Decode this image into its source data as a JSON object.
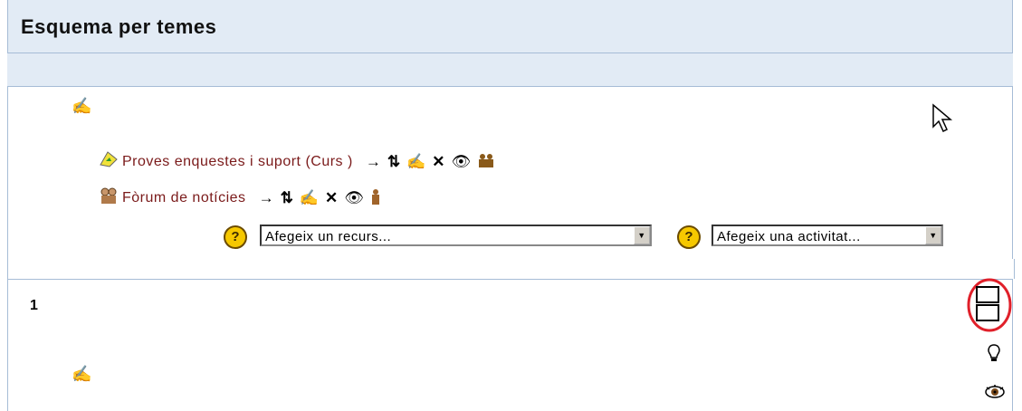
{
  "header": {
    "title": "Esquema per temes"
  },
  "section0": {
    "items": [
      {
        "label": "Proves enquestes i suport (Curs )",
        "icon": "chat-icon"
      },
      {
        "label": "Fòrum de notícies",
        "icon": "forum-icon"
      }
    ],
    "tool_icons": [
      "move-right-icon",
      "move-updown-icon",
      "edit-icon",
      "delete-icon",
      "visibility-icon",
      "groups-icon"
    ],
    "add_resource": {
      "value": "Afegeix un recurs..."
    },
    "add_activity": {
      "value": "Afegeix una activitat..."
    }
  },
  "section1": {
    "number": "1"
  },
  "colors": {
    "header_bg": "#e2ebf5",
    "border": "#a6bcd6",
    "link": "#7a1a1a",
    "highlight_circle": "#e0202a"
  }
}
